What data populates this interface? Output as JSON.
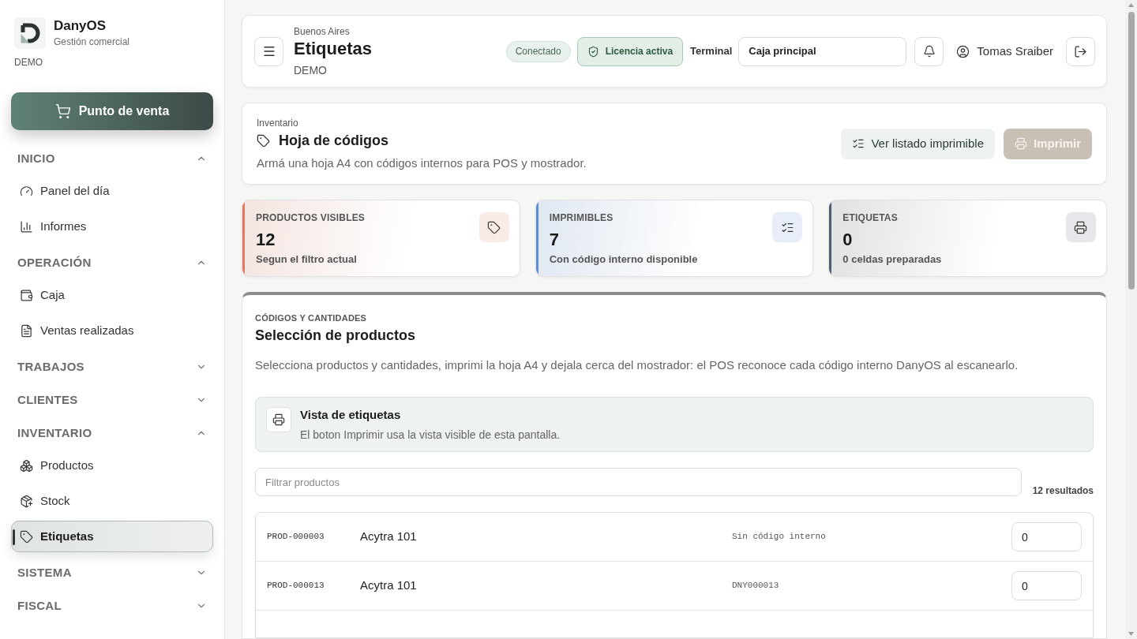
{
  "sidebar": {
    "brand": {
      "name": "DanyOS",
      "subtitle": "Gestión comercial",
      "environment": "DEMO"
    },
    "primary_action": {
      "label": "Punto de venta"
    },
    "groups": [
      {
        "title": "INICIO",
        "expanded": true,
        "items": [
          {
            "label": "Panel del día",
            "selected": false
          },
          {
            "label": "Informes",
            "selected": false
          }
        ]
      },
      {
        "title": "OPERACIÓN",
        "expanded": true,
        "items": [
          {
            "label": "Caja",
            "selected": false
          },
          {
            "label": "Ventas realizadas",
            "selected": false
          }
        ]
      },
      {
        "title": "TRABAJOS",
        "expanded": false
      },
      {
        "title": "CLIENTES",
        "expanded": false
      },
      {
        "title": "INVENTARIO",
        "expanded": true,
        "items": [
          {
            "label": "Productos",
            "selected": false
          },
          {
            "label": "Stock",
            "selected": false
          },
          {
            "label": "Etiquetas",
            "selected": true
          }
        ]
      },
      {
        "title": "SISTEMA",
        "expanded": false
      },
      {
        "title": "FISCAL",
        "expanded": false
      }
    ]
  },
  "header": {
    "location": "Buenos Aires",
    "title": "Etiquetas",
    "environment": "DEMO",
    "connection_status": "Conectado",
    "license_status": "Licencia activa",
    "terminal_label": "Terminal",
    "terminal": "Caja principal",
    "user": "Tomas Sraiber"
  },
  "page_header": {
    "breadcrumb": "Inventario",
    "title": "Hoja de códigos",
    "description": "Armá una hoja A4 con códigos internos para POS y mostrador.",
    "actions": [
      {
        "label": "Ver listado imprimible",
        "kind": "secondary",
        "disabled": false
      },
      {
        "label": "Imprimir",
        "kind": "primary",
        "disabled": true
      }
    ]
  },
  "stats": [
    {
      "label": "PRODUCTOS VISIBLES",
      "value": "12",
      "caption": "Segun el filtro actual",
      "color": "#e07a5f"
    },
    {
      "label": "IMPRIMIBLES",
      "value": "7",
      "caption": "Con código interno disponible",
      "color": "#5b8dd9"
    },
    {
      "label": "ETIQUETAS",
      "value": "0",
      "caption": "0 celdas preparadas",
      "color": "#4e5d72"
    }
  ],
  "selection": {
    "eyebrow": "CÓDIGOS Y CANTIDADES",
    "title": "Selección de productos",
    "description": "Selecciona productos y cantidades, imprimi la hoja A4 y dejala cerca del mostrador: el POS reconoce cada código interno DanyOS al escanearlo.",
    "notice": {
      "title": "Vista de etiquetas",
      "text": "El boton Imprimir usa la vista visible de esta pantalla."
    },
    "filter": {
      "placeholder": "Filtrar productos"
    },
    "result_count": "12 resultados",
    "rows": [
      {
        "code": "PROD-000003",
        "name": "Acytra 101",
        "internal_code": "Sin código interno",
        "quantity": "0"
      },
      {
        "code": "PROD-000013",
        "name": "Acytra 101",
        "internal_code": "DNY000013",
        "quantity": "0"
      }
    ]
  }
}
